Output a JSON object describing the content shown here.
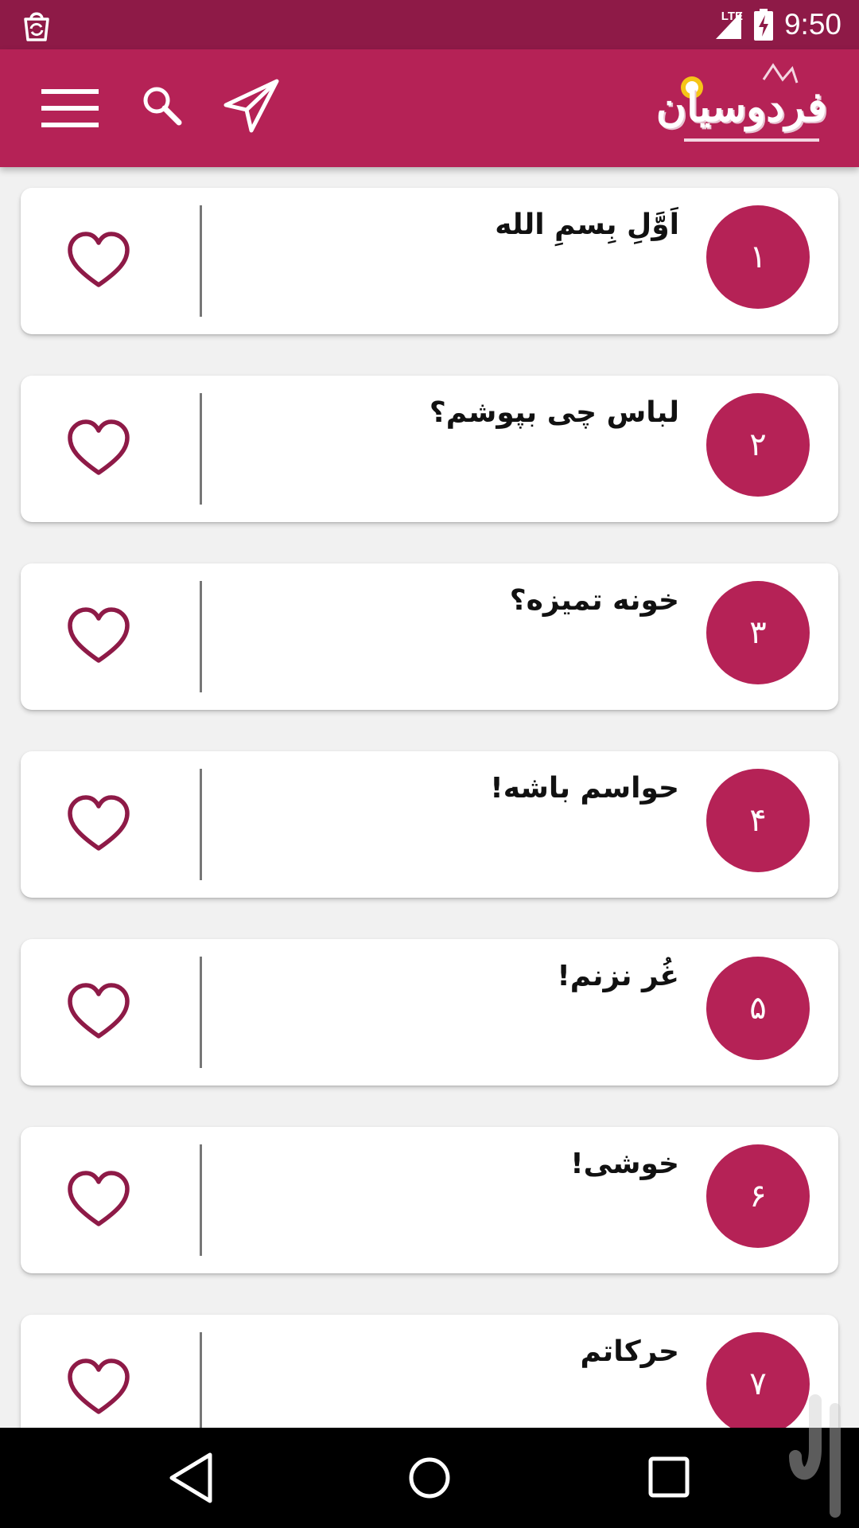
{
  "status_bar": {
    "time": "9:50",
    "network": "LTE"
  },
  "app_bar": {
    "logo_text": "فردوسیان",
    "icons": [
      "menu-icon",
      "search-icon",
      "send-icon"
    ]
  },
  "items": [
    {
      "number": "۱",
      "title": "اَوَّلِ بِسمِ الله"
    },
    {
      "number": "۲",
      "title": "لباس چی بپوشم؟"
    },
    {
      "number": "۳",
      "title": "خونه تمیزه؟"
    },
    {
      "number": "۴",
      "title": "حواسم باشه!"
    },
    {
      "number": "۵",
      "title": "غُر نزنم!"
    },
    {
      "number": "۶",
      "title": "خوشی!"
    },
    {
      "number": "۷",
      "title": "حرکاتم"
    }
  ],
  "colors": {
    "primary": "#b52256",
    "primary_dark": "#8e1a47",
    "heart": "#8e1a47",
    "background": "#f1f1f1"
  }
}
